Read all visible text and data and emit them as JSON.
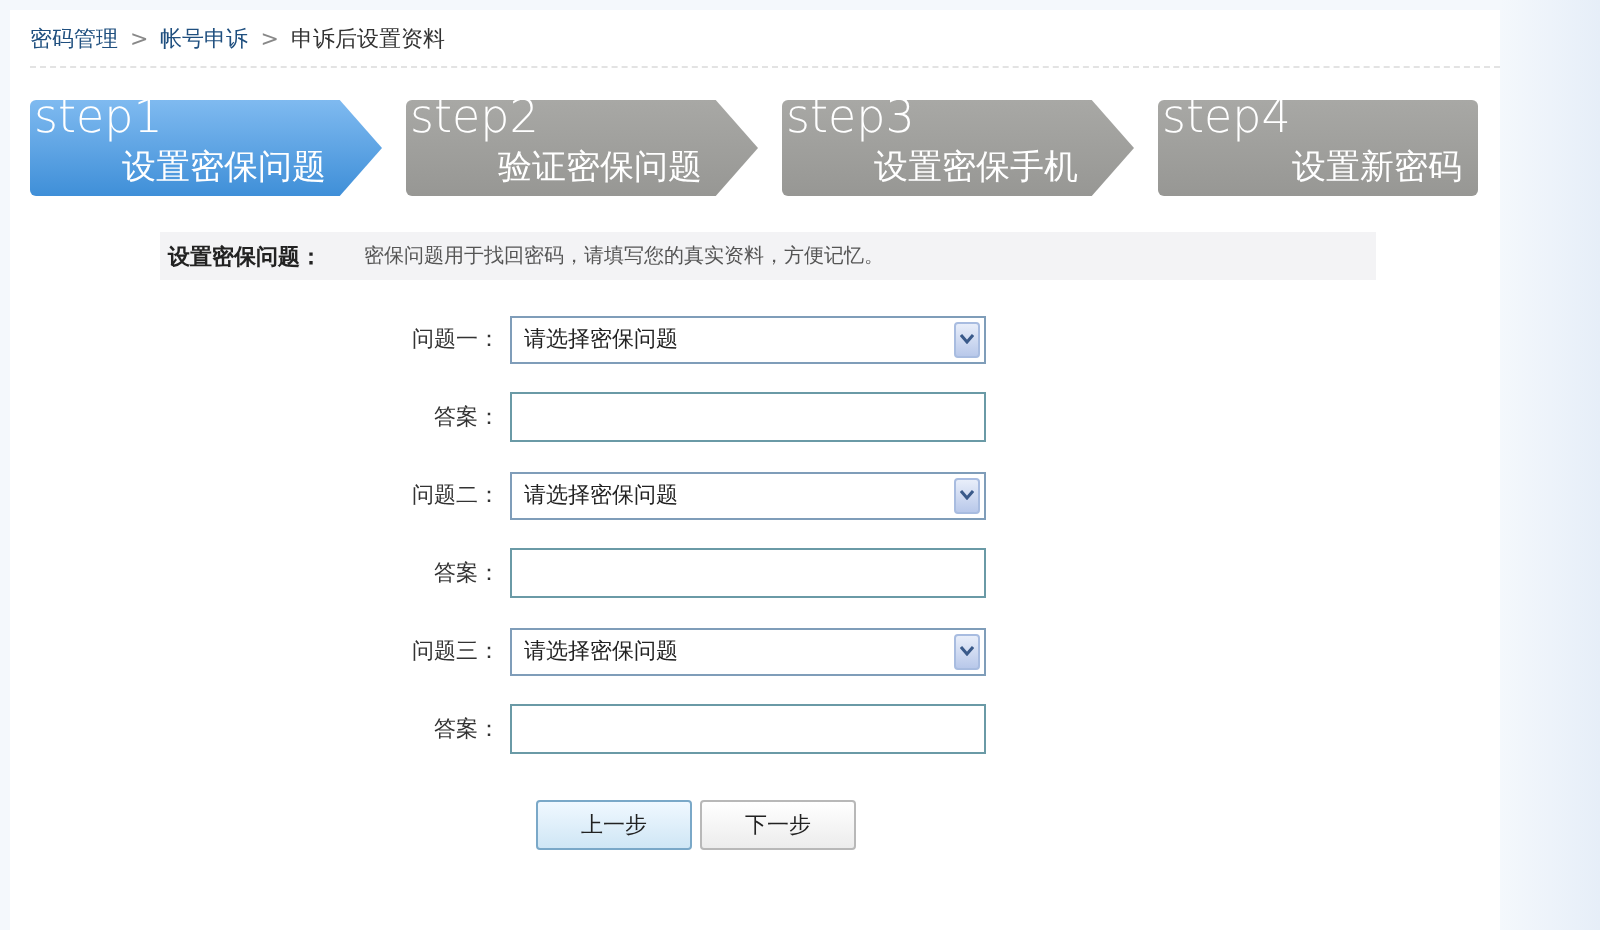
{
  "breadcrumb": [
    {
      "label": "密码管理",
      "link": true
    },
    {
      "label": "帐号申诉",
      "link": true
    },
    {
      "label": "申诉后设置资料",
      "link": false
    }
  ],
  "breadcrumb_separator": ">",
  "steps": [
    {
      "step": "step1",
      "label": "设置密保问题",
      "selected": true
    },
    {
      "step": "step2",
      "label": "验证密保问题",
      "selected": false
    },
    {
      "step": "step3",
      "label": "设置密保手机",
      "selected": false
    },
    {
      "step": "step4",
      "label": "设置新密码",
      "selected": false
    }
  ],
  "info": {
    "title": "设置密保问题：",
    "text": "密保问题用于找回密码，请填写您的真实资料，方便记忆。"
  },
  "fields": [
    {
      "kind": "select",
      "label": "问题一：",
      "value": "请选择密保问题"
    },
    {
      "kind": "text",
      "label": "答案："
    },
    {
      "kind": "select",
      "label": "问题二：",
      "value": "请选择密保问题"
    },
    {
      "kind": "text",
      "label": "答案："
    },
    {
      "kind": "select",
      "label": "问题三：",
      "value": "请选择密保问题"
    },
    {
      "kind": "text",
      "label": "答案："
    }
  ],
  "buttons": [
    {
      "label": "上一步",
      "selected": true
    },
    {
      "label": "下一步",
      "selected": false
    }
  ]
}
